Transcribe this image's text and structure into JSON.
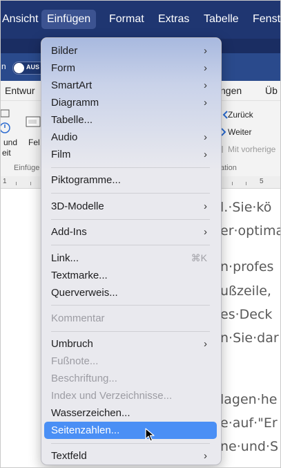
{
  "menubar": {
    "items": [
      {
        "label": "Ansicht"
      },
      {
        "label": "Einfügen",
        "active": true
      },
      {
        "label": "Format"
      },
      {
        "label": "Extras"
      },
      {
        "label": "Tabelle"
      },
      {
        "label": "Fenst"
      }
    ]
  },
  "toolbar": {
    "left_partial": "n",
    "autosave_label": "AUS"
  },
  "ribbon": {
    "tab_left": "Entwur",
    "tab_right": "ngen",
    "tab_far_right": "Üb",
    "left_labels": [
      "und",
      "eit",
      "Fel"
    ],
    "group_left": "Einfüge",
    "group_right": "ation",
    "nav_back": "Zurück",
    "nav_forward": "Weiter",
    "nav_previous": "Mit vorherige"
  },
  "ruler": {
    "marks": [
      "1",
      "5"
    ]
  },
  "document": {
    "lines": [
      "l.·Sie·kö",
      "er·optima",
      "n·profes",
      "ußzeile,",
      "es·Deck",
      "n·Sie·dar",
      "lagen·he",
      "e·auf·\"Er",
      "ne·und·S"
    ]
  },
  "menu": {
    "items": [
      {
        "label": "Bilder",
        "submenu": true
      },
      {
        "label": "Form",
        "submenu": true
      },
      {
        "label": "SmartArt",
        "submenu": true
      },
      {
        "label": "Diagramm",
        "submenu": true
      },
      {
        "label": "Tabelle...",
        "submenu": false
      },
      {
        "label": "Audio",
        "submenu": true
      },
      {
        "label": "Film",
        "submenu": true
      },
      {
        "label": "Piktogramme..."
      },
      {
        "label": "3D-Modelle",
        "submenu": true
      },
      {
        "label": "Add-Ins",
        "submenu": true
      },
      {
        "label": "Link...",
        "shortcut": "⌘K"
      },
      {
        "label": "Textmarke..."
      },
      {
        "label": "Querverweis..."
      },
      {
        "label": "Kommentar",
        "disabled": true
      },
      {
        "label": "Umbruch",
        "submenu": true
      },
      {
        "label": "Fußnote...",
        "disabled": true
      },
      {
        "label": "Beschriftung...",
        "disabled": true
      },
      {
        "label": "Index und Verzeichnisse...",
        "disabled": true
      },
      {
        "label": "Wasserzeichen..."
      },
      {
        "label": "Seitenzahlen...",
        "selected": true
      },
      {
        "label": "Textfeld",
        "submenu": true
      }
    ]
  },
  "colors": {
    "menubar_bg": "#1f3671",
    "selection": "#4a8ff5",
    "menu_bg": "#e9e9ee"
  }
}
